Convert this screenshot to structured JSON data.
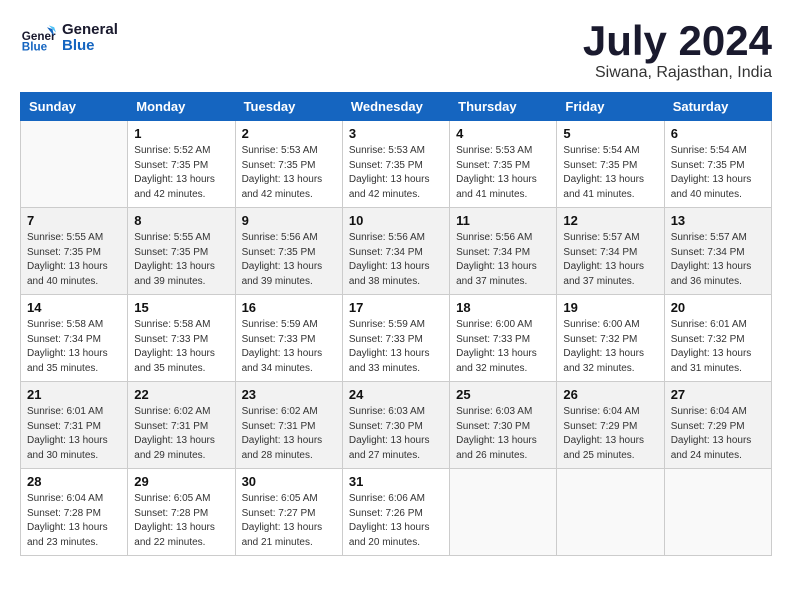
{
  "header": {
    "logo_line1": "General",
    "logo_line2": "Blue",
    "title": "July 2024",
    "subtitle": "Siwana, Rajasthan, India"
  },
  "columns": [
    "Sunday",
    "Monday",
    "Tuesday",
    "Wednesday",
    "Thursday",
    "Friday",
    "Saturday"
  ],
  "weeks": [
    [
      {
        "day": "",
        "info": ""
      },
      {
        "day": "1",
        "info": "Sunrise: 5:52 AM\nSunset: 7:35 PM\nDaylight: 13 hours\nand 42 minutes."
      },
      {
        "day": "2",
        "info": "Sunrise: 5:53 AM\nSunset: 7:35 PM\nDaylight: 13 hours\nand 42 minutes."
      },
      {
        "day": "3",
        "info": "Sunrise: 5:53 AM\nSunset: 7:35 PM\nDaylight: 13 hours\nand 42 minutes."
      },
      {
        "day": "4",
        "info": "Sunrise: 5:53 AM\nSunset: 7:35 PM\nDaylight: 13 hours\nand 41 minutes."
      },
      {
        "day": "5",
        "info": "Sunrise: 5:54 AM\nSunset: 7:35 PM\nDaylight: 13 hours\nand 41 minutes."
      },
      {
        "day": "6",
        "info": "Sunrise: 5:54 AM\nSunset: 7:35 PM\nDaylight: 13 hours\nand 40 minutes."
      }
    ],
    [
      {
        "day": "7",
        "info": "Sunrise: 5:55 AM\nSunset: 7:35 PM\nDaylight: 13 hours\nand 40 minutes."
      },
      {
        "day": "8",
        "info": "Sunrise: 5:55 AM\nSunset: 7:35 PM\nDaylight: 13 hours\nand 39 minutes."
      },
      {
        "day": "9",
        "info": "Sunrise: 5:56 AM\nSunset: 7:35 PM\nDaylight: 13 hours\nand 39 minutes."
      },
      {
        "day": "10",
        "info": "Sunrise: 5:56 AM\nSunset: 7:34 PM\nDaylight: 13 hours\nand 38 minutes."
      },
      {
        "day": "11",
        "info": "Sunrise: 5:56 AM\nSunset: 7:34 PM\nDaylight: 13 hours\nand 37 minutes."
      },
      {
        "day": "12",
        "info": "Sunrise: 5:57 AM\nSunset: 7:34 PM\nDaylight: 13 hours\nand 37 minutes."
      },
      {
        "day": "13",
        "info": "Sunrise: 5:57 AM\nSunset: 7:34 PM\nDaylight: 13 hours\nand 36 minutes."
      }
    ],
    [
      {
        "day": "14",
        "info": "Sunrise: 5:58 AM\nSunset: 7:34 PM\nDaylight: 13 hours\nand 35 minutes."
      },
      {
        "day": "15",
        "info": "Sunrise: 5:58 AM\nSunset: 7:33 PM\nDaylight: 13 hours\nand 35 minutes."
      },
      {
        "day": "16",
        "info": "Sunrise: 5:59 AM\nSunset: 7:33 PM\nDaylight: 13 hours\nand 34 minutes."
      },
      {
        "day": "17",
        "info": "Sunrise: 5:59 AM\nSunset: 7:33 PM\nDaylight: 13 hours\nand 33 minutes."
      },
      {
        "day": "18",
        "info": "Sunrise: 6:00 AM\nSunset: 7:33 PM\nDaylight: 13 hours\nand 32 minutes."
      },
      {
        "day": "19",
        "info": "Sunrise: 6:00 AM\nSunset: 7:32 PM\nDaylight: 13 hours\nand 32 minutes."
      },
      {
        "day": "20",
        "info": "Sunrise: 6:01 AM\nSunset: 7:32 PM\nDaylight: 13 hours\nand 31 minutes."
      }
    ],
    [
      {
        "day": "21",
        "info": "Sunrise: 6:01 AM\nSunset: 7:31 PM\nDaylight: 13 hours\nand 30 minutes."
      },
      {
        "day": "22",
        "info": "Sunrise: 6:02 AM\nSunset: 7:31 PM\nDaylight: 13 hours\nand 29 minutes."
      },
      {
        "day": "23",
        "info": "Sunrise: 6:02 AM\nSunset: 7:31 PM\nDaylight: 13 hours\nand 28 minutes."
      },
      {
        "day": "24",
        "info": "Sunrise: 6:03 AM\nSunset: 7:30 PM\nDaylight: 13 hours\nand 27 minutes."
      },
      {
        "day": "25",
        "info": "Sunrise: 6:03 AM\nSunset: 7:30 PM\nDaylight: 13 hours\nand 26 minutes."
      },
      {
        "day": "26",
        "info": "Sunrise: 6:04 AM\nSunset: 7:29 PM\nDaylight: 13 hours\nand 25 minutes."
      },
      {
        "day": "27",
        "info": "Sunrise: 6:04 AM\nSunset: 7:29 PM\nDaylight: 13 hours\nand 24 minutes."
      }
    ],
    [
      {
        "day": "28",
        "info": "Sunrise: 6:04 AM\nSunset: 7:28 PM\nDaylight: 13 hours\nand 23 minutes."
      },
      {
        "day": "29",
        "info": "Sunrise: 6:05 AM\nSunset: 7:28 PM\nDaylight: 13 hours\nand 22 minutes."
      },
      {
        "day": "30",
        "info": "Sunrise: 6:05 AM\nSunset: 7:27 PM\nDaylight: 13 hours\nand 21 minutes."
      },
      {
        "day": "31",
        "info": "Sunrise: 6:06 AM\nSunset: 7:26 PM\nDaylight: 13 hours\nand 20 minutes."
      },
      {
        "day": "",
        "info": ""
      },
      {
        "day": "",
        "info": ""
      },
      {
        "day": "",
        "info": ""
      }
    ]
  ]
}
